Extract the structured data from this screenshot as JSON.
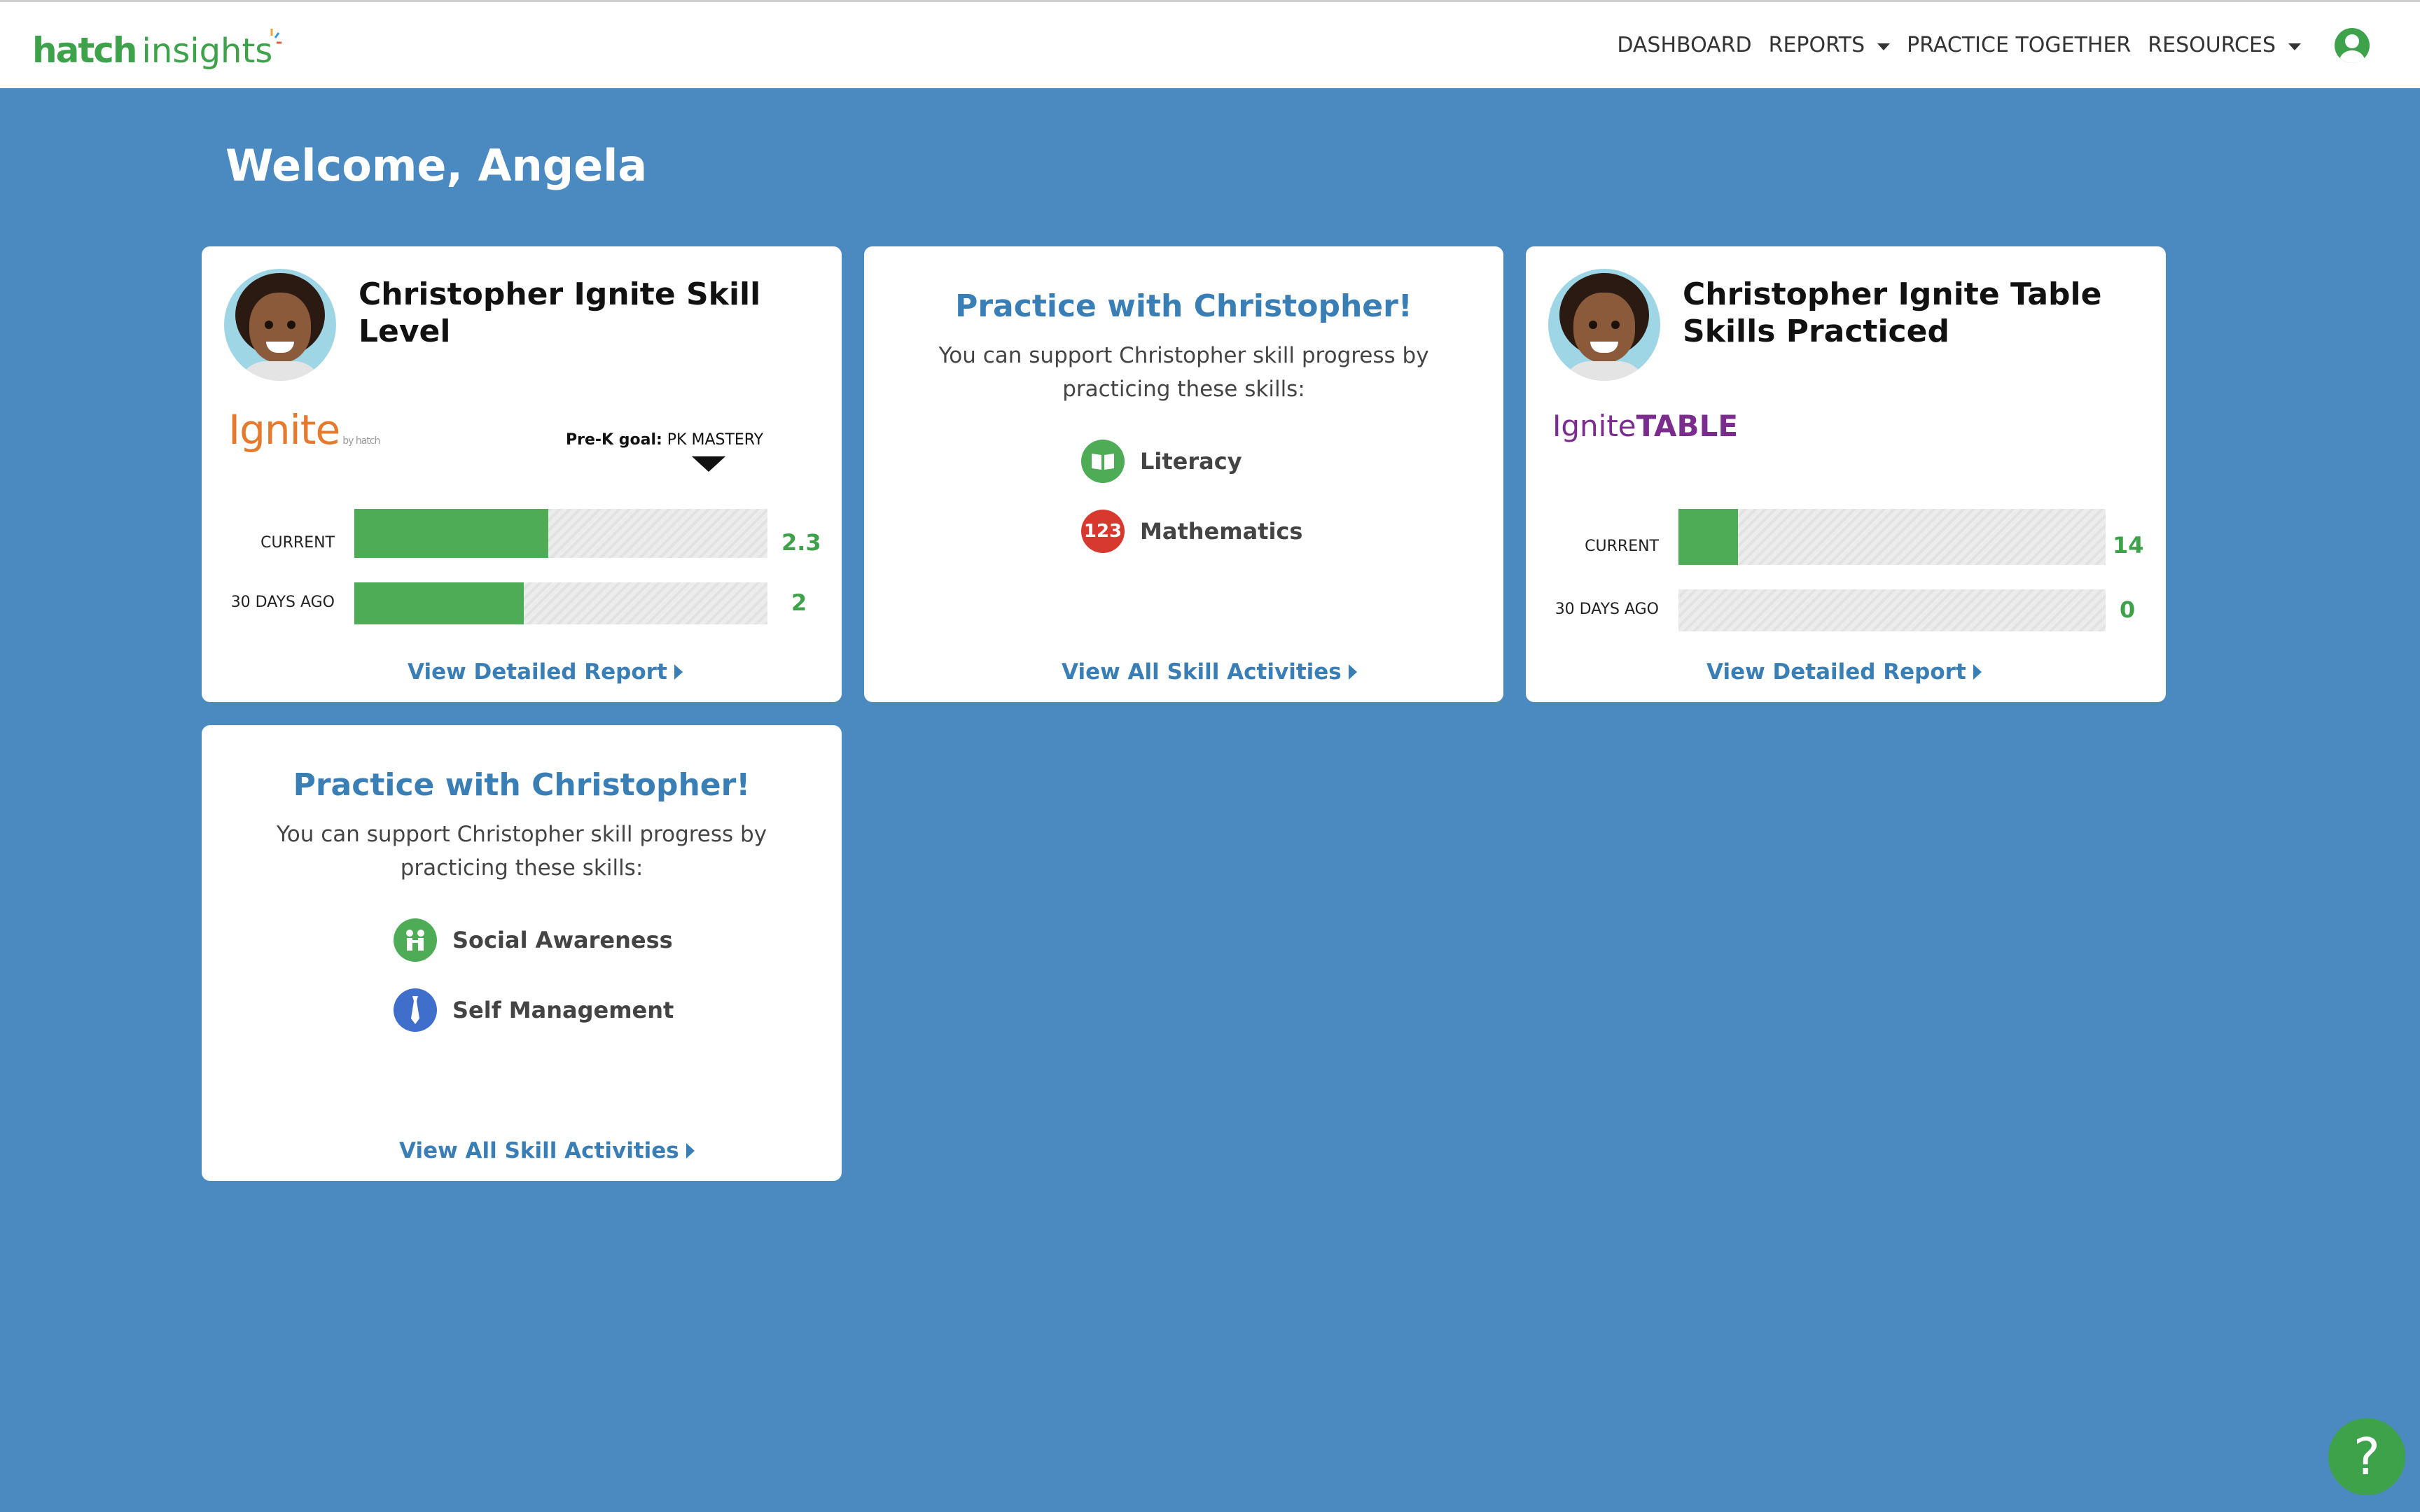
{
  "brand": {
    "hatch": "hatch",
    "insights": "insights"
  },
  "nav": {
    "dashboard": "DASHBOARD",
    "reports": "REPORTS",
    "practice_together": "PRACTICE TOGETHER",
    "resources": "RESOURCES"
  },
  "welcome": "Welcome, Angela",
  "skill_level_card": {
    "title": "Christopher Ignite Skill Level",
    "brand": "Ignite",
    "brand_sub": "by hatch",
    "goal_label": "Pre-K goal:",
    "goal_value": "PK MASTERY",
    "rows": [
      {
        "label": "CURRENT",
        "value": "2.3",
        "fill": 0.47
      },
      {
        "label": "30 DAYS AGO",
        "value": "2",
        "fill": 0.41
      }
    ],
    "link": "View Detailed Report"
  },
  "practice_card_1": {
    "title": "Practice with Christopher!",
    "subtitle": "You can support Christopher skill progress by practicing these skills:",
    "skills": [
      {
        "label": "Literacy",
        "icon": "book-icon",
        "color": "#4eac57"
      },
      {
        "label": "Mathematics",
        "icon": "numbers-icon",
        "color": "#d8392f"
      }
    ],
    "link": "View All Skill Activities"
  },
  "table_card": {
    "title": "Christopher Ignite Table Skills Practiced",
    "brand_a": "Ignite",
    "brand_b": "TABLE",
    "rows": [
      {
        "label": "CURRENT",
        "value": "14",
        "fill": 0.14
      },
      {
        "label": "30 DAYS AGO",
        "value": "0",
        "fill": 0
      }
    ],
    "link": "View Detailed Report"
  },
  "practice_card_2": {
    "title": "Practice with Christopher!",
    "subtitle": "You can support Christopher skill progress by practicing these skills:",
    "skills": [
      {
        "label": "Social Awareness",
        "icon": "people-icon",
        "color": "#4eac57"
      },
      {
        "label": "Self Management",
        "icon": "tie-icon",
        "color": "#3f6fcb"
      }
    ],
    "link": "View All Skill Activities"
  },
  "help": "?"
}
